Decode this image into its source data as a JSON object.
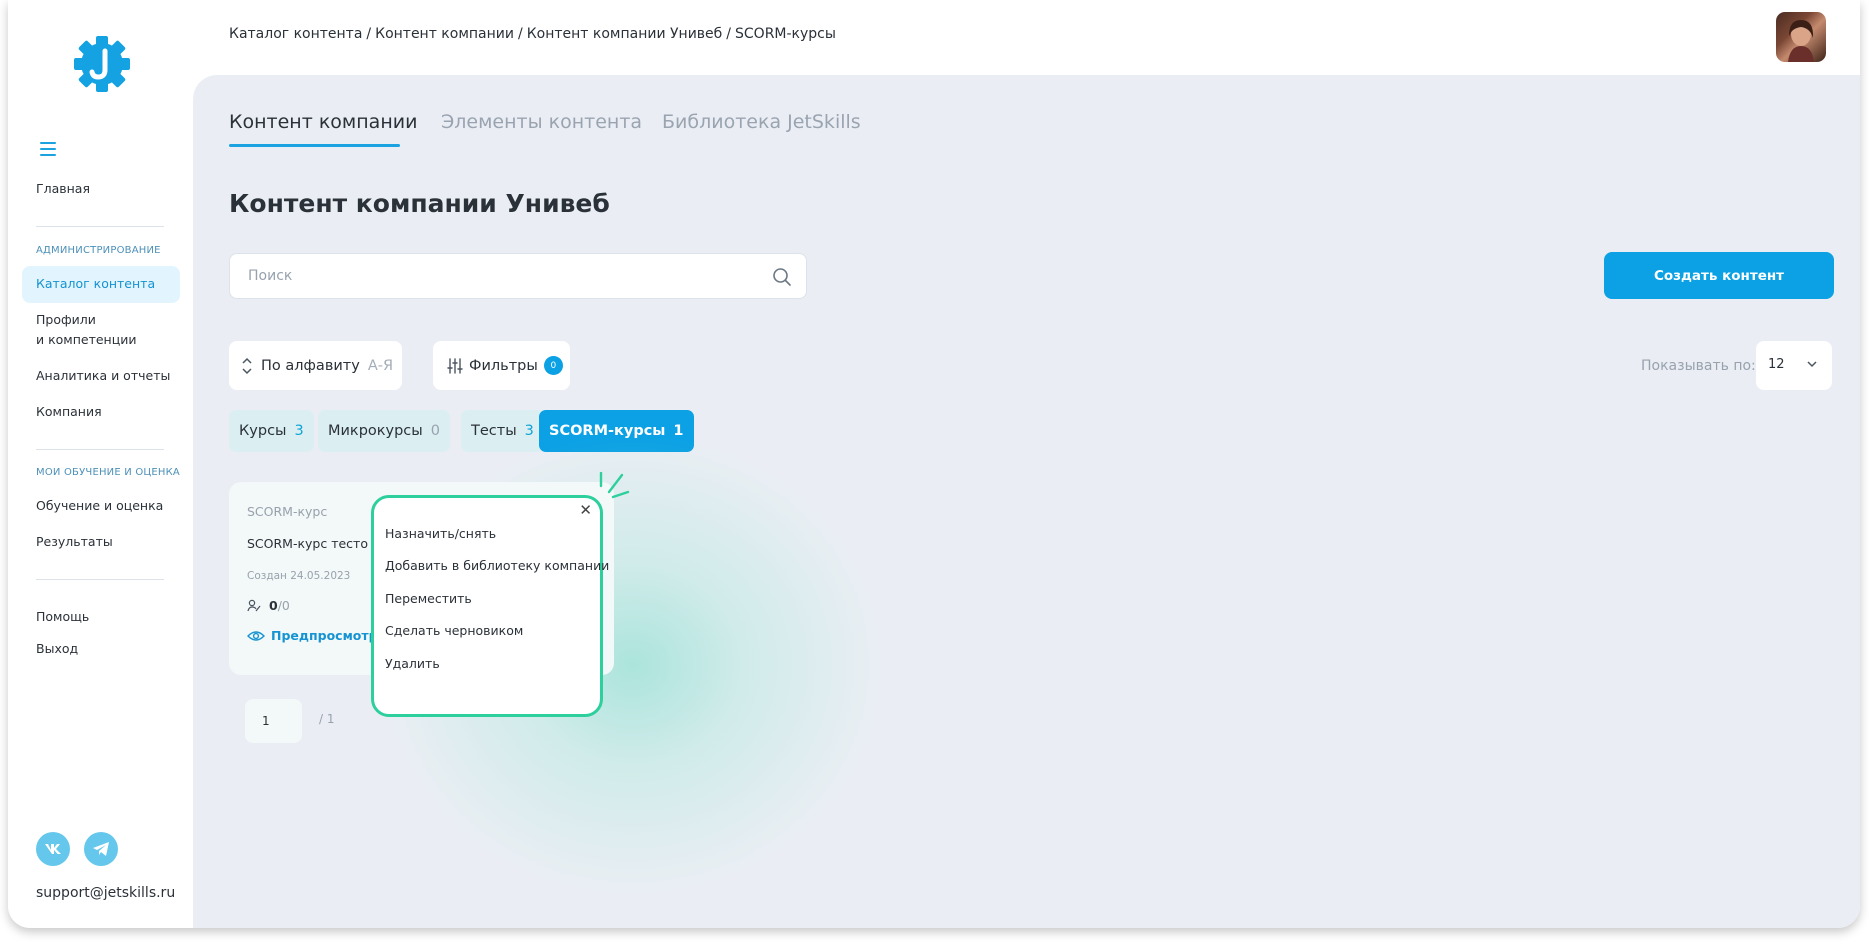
{
  "breadcrumb": [
    "Каталог контента",
    "Контент компании",
    "Контент компании Унивеб",
    "SCORM-курсы"
  ],
  "sidebar": {
    "home": "Главная",
    "admin_section": "АДМИНИСТРИРОВАНИЕ",
    "catalog": "Каталог контента",
    "profiles_line1": "Профили",
    "profiles_line2": "и компетенции",
    "analytics": "Аналитика и отчеты",
    "company": "Компания",
    "learning_section": "МОИ ОБУЧЕНИЕ И ОЦЕНКА",
    "learning": "Обучение и оценка",
    "results": "Результаты",
    "help": "Помощь",
    "logout": "Выход",
    "email": "support@jetskills.ru"
  },
  "tabs": [
    "Контент компании",
    "Элементы контента",
    "Библиотека JetSkills"
  ],
  "page_title": "Контент компании Унивеб",
  "search": {
    "placeholder": "Поиск"
  },
  "create_button": "Создать контент",
  "sort": {
    "label": "По алфавиту",
    "order": "А-Я"
  },
  "filters": {
    "label": "Фильтры",
    "count": "0"
  },
  "page_size": {
    "label": "Показывать по:",
    "value": "12"
  },
  "chips": [
    {
      "label": "Курсы",
      "count": "3"
    },
    {
      "label": "Микрокурсы",
      "count": "0"
    },
    {
      "label": "Тесты",
      "count": "3"
    },
    {
      "label": "SCORM-курсы",
      "count": "1"
    }
  ],
  "card": {
    "type": "SCORM-курс",
    "title": "SCORM-курс тесто",
    "date": "Создан 24.05.2023",
    "stats_a": "0",
    "stats_b": "/0",
    "preview": "Предпросмотр"
  },
  "pager": {
    "current": "1",
    "total": "/ 1"
  },
  "popup_menu": {
    "close": "✕",
    "items": [
      "Назначить/снять",
      "Добавить в библиотеку компании",
      "Переместить",
      "Сделать черновиком",
      "Удалить"
    ]
  },
  "colors": {
    "accent": "#0ba1e4",
    "highlight": "#2dd09c",
    "background": "#eaeef4"
  }
}
